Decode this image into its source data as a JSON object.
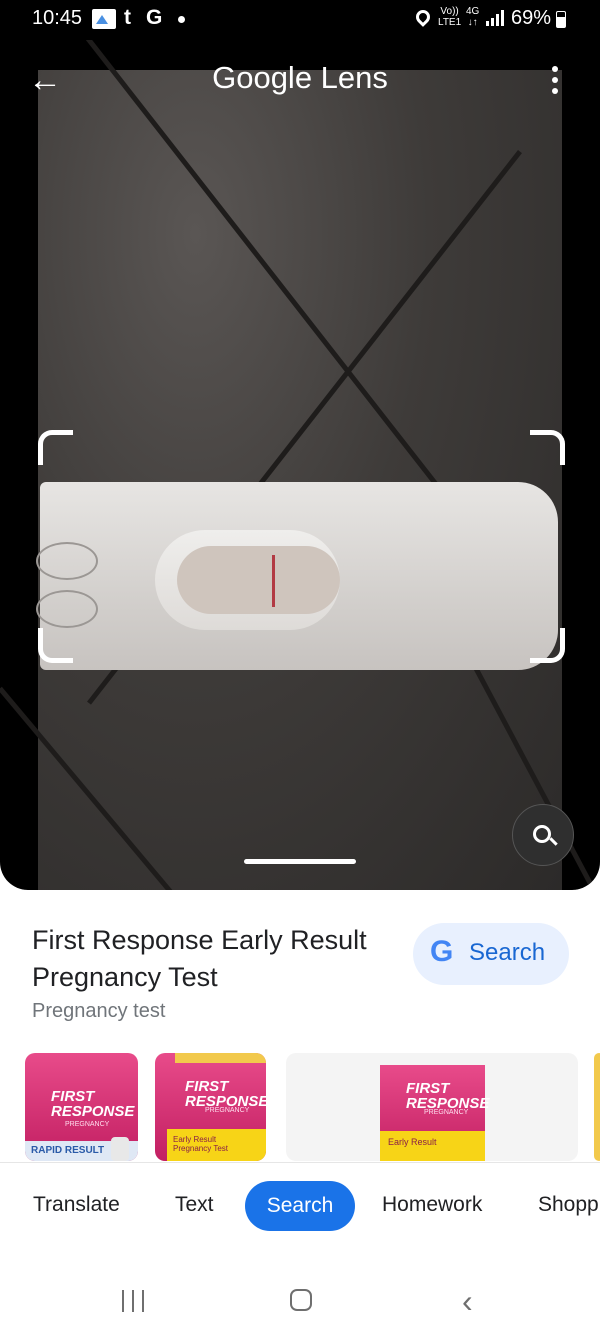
{
  "status_bar": {
    "time": "10:45",
    "icons": [
      "gallery-icon",
      "tumblr-icon",
      "google-icon",
      "notification-dot-icon"
    ],
    "t_glyph": "t",
    "g_glyph": "G",
    "volte_line1": "Vo))",
    "volte_line2": "LTE1",
    "network_line1": "4G",
    "network_line2": "↓↑",
    "battery": "69%",
    "battery_level": 0.69
  },
  "header": {
    "title": "Google Lens",
    "back_icon": "←",
    "menu_icon": "more-vertical-icon"
  },
  "viewer": {
    "overlay_icon": "lens-search-icon"
  },
  "result": {
    "title": "First Response Early Result Pregnancy Test",
    "category": "Pregnancy test",
    "search_button": "Search",
    "google_g": "G"
  },
  "thumbnails": [
    {
      "brand_line1": "FIRST",
      "brand_line2": "RESPONSE",
      "sub": "PREGNANCY",
      "foot": "RAPID RESULT"
    },
    {
      "brand_line1": "FIRST",
      "brand_line2": "RESPONSE",
      "sub": "PREGNANCY",
      "foot": "Early Result Pregnancy Test"
    },
    {
      "brand_line1": "FIRST",
      "brand_line2": "RESPONSE",
      "sub": "PREGNANCY",
      "foot": "Early Result"
    }
  ],
  "tabs": [
    "Translate",
    "Text",
    "Search",
    "Homework",
    "Shopp"
  ],
  "active_tab": "Search",
  "nav": {
    "back": "‹"
  }
}
